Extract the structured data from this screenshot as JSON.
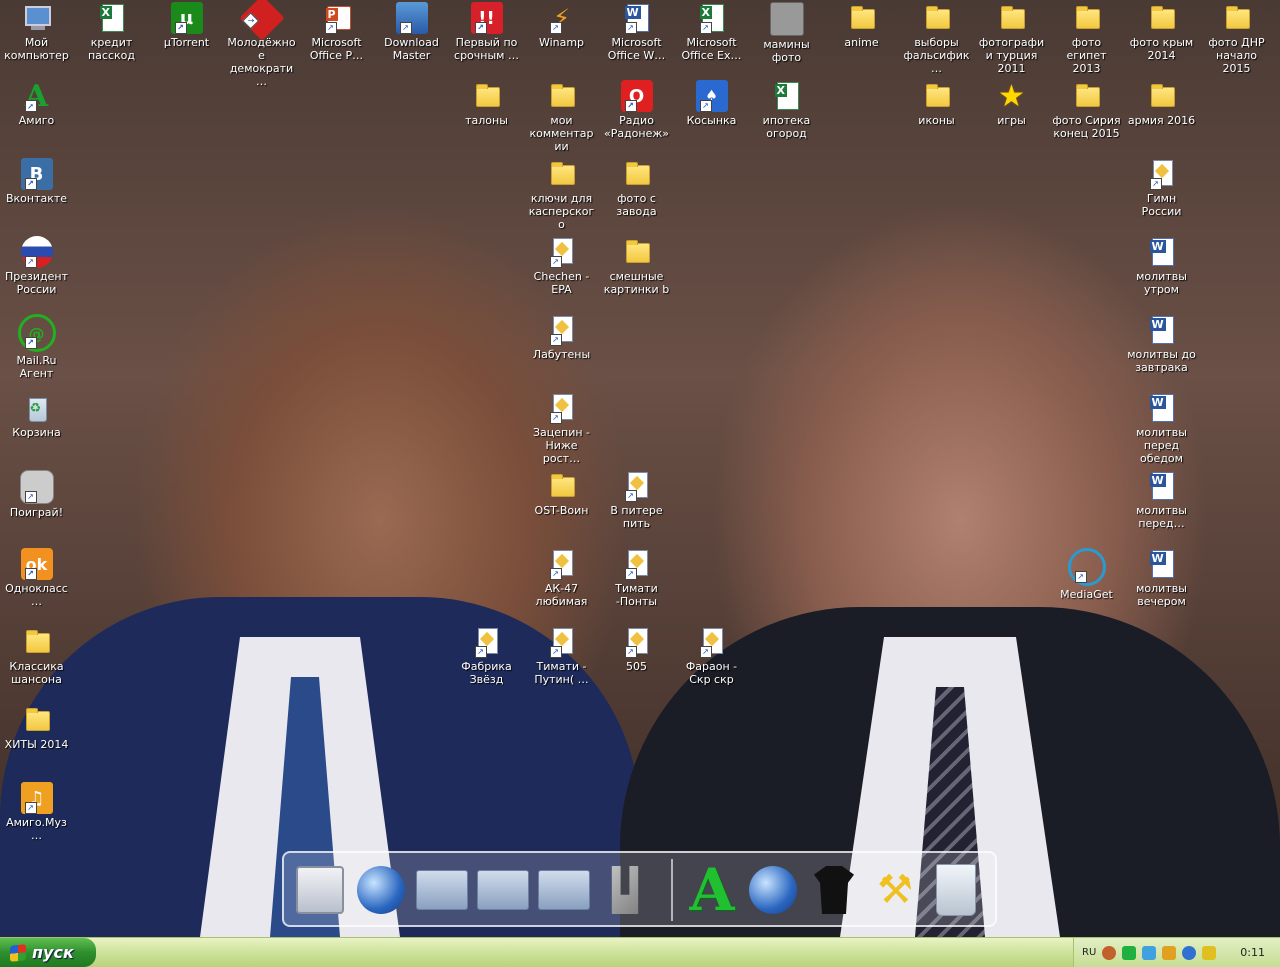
{
  "desktop": {
    "col1": [
      {
        "label": "Мой компьютер",
        "icon": "my-computer-icon"
      },
      {
        "label": "Амиго",
        "icon": "amigo-icon"
      },
      {
        "label": "Вконтакте",
        "icon": "vk-icon"
      },
      {
        "label": "Президент России",
        "icon": "russia-flag-icon"
      },
      {
        "label": "Mail.Ru Агент",
        "icon": "mailru-agent-icon"
      },
      {
        "label": "Корзина",
        "icon": "recycle-bin-icon"
      },
      {
        "label": "Поиграй!",
        "icon": "gamepad-icon"
      },
      {
        "label": "Однокласс…",
        "icon": "odnoklassniki-icon"
      },
      {
        "label": "Классика шансона",
        "icon": "folder-icon"
      },
      {
        "label": "ХИТЫ 2014",
        "icon": "folder-icon"
      },
      {
        "label": "Амиго.Муз…",
        "icon": "amigo-music-icon"
      }
    ],
    "row1": [
      {
        "label": "кредит пасскод",
        "icon": "excel-file-icon"
      },
      {
        "label": "µTorrent",
        "icon": "utorrent-icon"
      },
      {
        "label": "Молодёжное демократи…",
        "icon": "red-grid-icon"
      },
      {
        "label": "Microsoft Office P…",
        "icon": "powerpoint-icon"
      },
      {
        "label": "Download Master",
        "icon": "download-master-icon"
      },
      {
        "label": "Первый по срочным …",
        "icon": "red-alert-icon"
      },
      {
        "label": "Winamp",
        "icon": "winamp-icon"
      },
      {
        "label": "Microsoft Office W…",
        "icon": "word-icon"
      },
      {
        "label": "Microsoft Office Ex…",
        "icon": "excel-icon"
      },
      {
        "label": "мамины фото",
        "icon": "camera-icon"
      },
      {
        "label": "anime",
        "icon": "folder-icon"
      },
      {
        "label": "выборы фальсифик…",
        "icon": "folder-icon"
      },
      {
        "label": "фотографии турция 2011",
        "icon": "folder-icon"
      },
      {
        "label": "фото египет 2013",
        "icon": "folder-icon"
      },
      {
        "label": "фото крым 2014",
        "icon": "folder-icon"
      },
      {
        "label": "фото ДНР начало 2015",
        "icon": "folder-icon"
      }
    ],
    "grid": [
      {
        "label": "талоны",
        "icon": "folder-icon",
        "col": 7,
        "row": 2
      },
      {
        "label": "мои комментарии",
        "icon": "folder-icon",
        "col": 8,
        "row": 2
      },
      {
        "label": "Радио «Радонеж»",
        "icon": "opera-icon",
        "col": 9,
        "row": 2
      },
      {
        "label": "Косынка",
        "icon": "solitaire-icon",
        "col": 10,
        "row": 2
      },
      {
        "label": "ипотека огород",
        "icon": "excel-file-icon",
        "col": 11,
        "row": 2
      },
      {
        "label": "иконы",
        "icon": "folder-icon",
        "col": 13,
        "row": 2
      },
      {
        "label": "игры",
        "icon": "star-icon",
        "col": 14,
        "row": 2
      },
      {
        "label": "фото Сирия конец 2015",
        "icon": "folder-icon",
        "col": 15,
        "row": 2
      },
      {
        "label": "армия 2016",
        "icon": "folder-icon",
        "col": 16,
        "row": 2
      },
      {
        "label": "ключи для касперского",
        "icon": "folder-icon",
        "col": 8,
        "row": 3
      },
      {
        "label": "фото с завода",
        "icon": "folder-icon",
        "col": 9,
        "row": 3
      },
      {
        "label": "Гимн России",
        "icon": "audio-file-icon",
        "col": 16,
        "row": 3
      },
      {
        "label": "Chechen - EPA",
        "icon": "audio-file-icon",
        "col": 8,
        "row": 4
      },
      {
        "label": "смешные картинки b",
        "icon": "folder-icon",
        "col": 9,
        "row": 4
      },
      {
        "label": "молитвы утром",
        "icon": "word-doc-icon",
        "col": 16,
        "row": 4
      },
      {
        "label": "Лабутены",
        "icon": "audio-file-icon",
        "col": 8,
        "row": 5
      },
      {
        "label": "молитвы до завтрака",
        "icon": "word-doc-icon",
        "col": 16,
        "row": 5
      },
      {
        "label": "Зацепин - Ниже рост…",
        "icon": "audio-file-icon",
        "col": 8,
        "row": 6
      },
      {
        "label": "молитвы перед обедом",
        "icon": "word-doc-icon",
        "col": 16,
        "row": 6
      },
      {
        "label": "OST-Воин",
        "icon": "folder-icon",
        "col": 8,
        "row": 7
      },
      {
        "label": "В питере пить",
        "icon": "audio-file-icon",
        "col": 9,
        "row": 7
      },
      {
        "label": "молитвы перед…",
        "icon": "word-doc-icon",
        "col": 16,
        "row": 7
      },
      {
        "label": "АК-47 любимая",
        "icon": "audio-file-icon",
        "col": 8,
        "row": 8
      },
      {
        "label": "Тимати -Понты",
        "icon": "audio-file-icon",
        "col": 9,
        "row": 8
      },
      {
        "label": "MediaGet",
        "icon": "mediaget-icon",
        "col": 15,
        "row": 8
      },
      {
        "label": "молитвы вечером",
        "icon": "word-doc-icon",
        "col": 16,
        "row": 8
      },
      {
        "label": "Фабрика Звёзд",
        "icon": "audio-file-icon",
        "col": 7,
        "row": 9
      },
      {
        "label": "Тимати - Путин( …",
        "icon": "audio-file-icon",
        "col": 8,
        "row": 9
      },
      {
        "label": "505",
        "icon": "audio-file-icon",
        "col": 9,
        "row": 9
      },
      {
        "label": "Фараон - Скр скр",
        "icon": "audio-file-icon",
        "col": 10,
        "row": 9
      }
    ]
  },
  "dock": {
    "left": [
      "desktop-screen-icon",
      "globe-icon",
      "documents-folder-icon",
      "music-folder-icon",
      "pictures-folder-icon",
      "tools-icon"
    ],
    "right": [
      "amigo-icon",
      "internet-globe-icon",
      "tshirt-icon",
      "hammer-icon",
      "recycle-bin-icon"
    ]
  },
  "taskbar": {
    "start_label": "пуск",
    "lang": "RU",
    "clock": "0:11"
  }
}
